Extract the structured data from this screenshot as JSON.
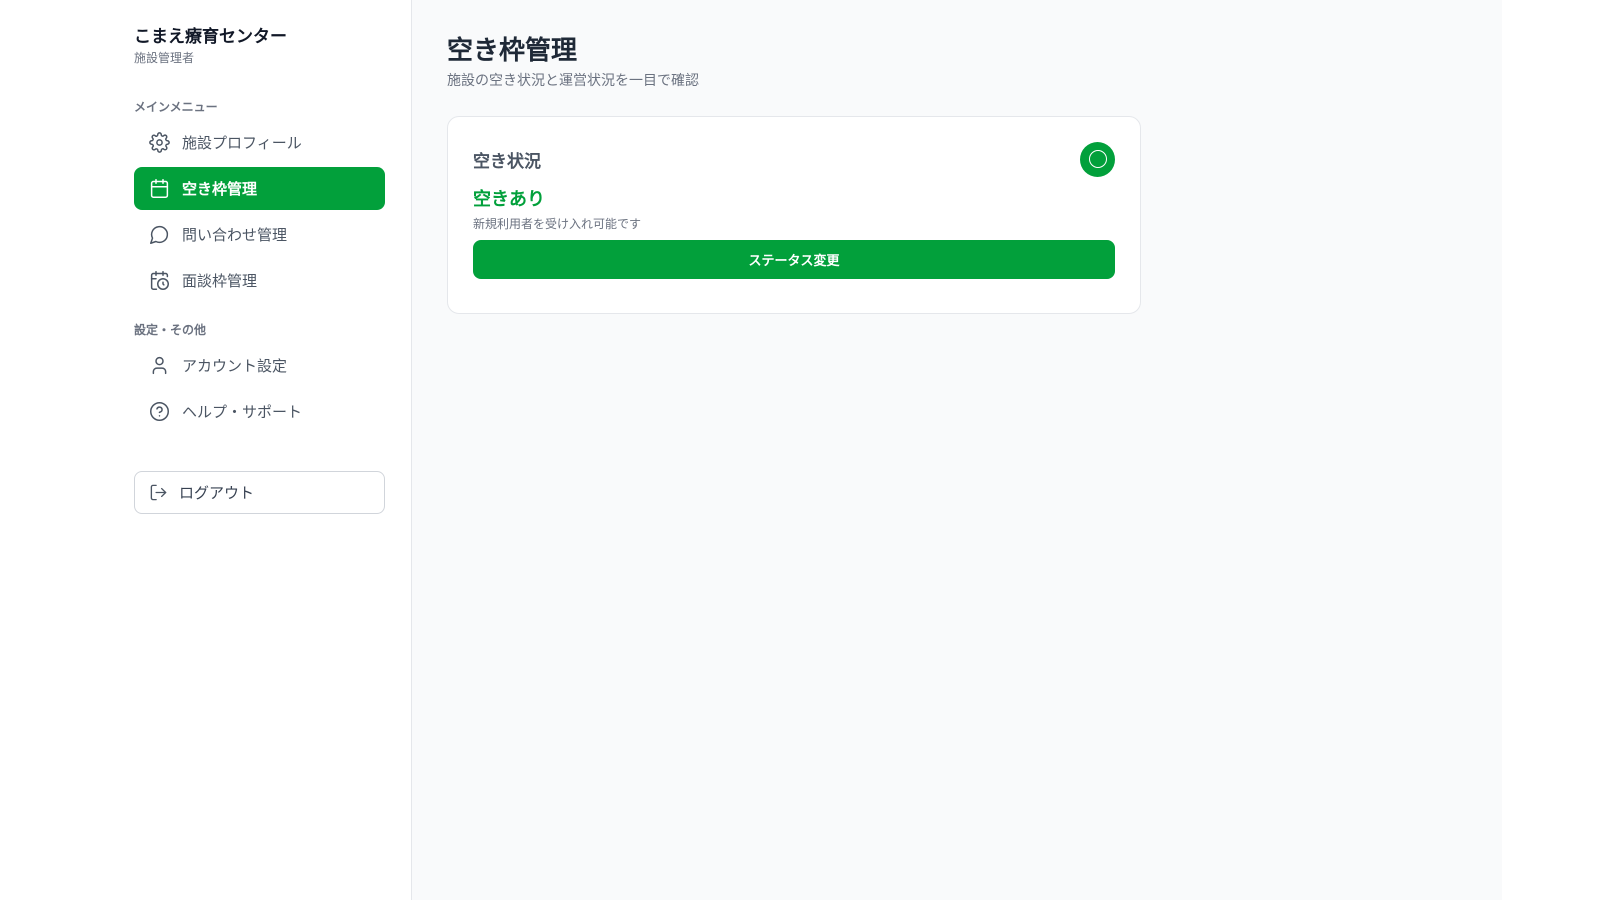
{
  "sidebar": {
    "brand_title": "こまえ療育センター",
    "brand_sub": "施設管理者",
    "section_main": "メインメニュー",
    "main_items": [
      {
        "label": "施設プロフィール",
        "icon": "gear-icon",
        "active": false
      },
      {
        "label": "空き枠管理",
        "icon": "calendar-icon",
        "active": true
      },
      {
        "label": "問い合わせ管理",
        "icon": "chat-bubble-icon",
        "active": false
      },
      {
        "label": "面談枠管理",
        "icon": "calendar-clock-icon",
        "active": false
      }
    ],
    "section_other": "設定・その他",
    "other_items": [
      {
        "label": "アカウント設定",
        "icon": "user-icon"
      },
      {
        "label": "ヘルプ・サポート",
        "icon": "help-circle-icon"
      }
    ],
    "logout_label": "ログアウト"
  },
  "main": {
    "page_title": "空き枠管理",
    "page_sub": "施設の空き状況と運営状況を一目で確認",
    "card": {
      "title": "空き状況",
      "status_value": "空きあり",
      "status_desc": "新規利用者を受け入れ可能です",
      "button_label": "ステータス変更"
    }
  },
  "colors": {
    "accent": "#02a03b",
    "main_bg": "#f9fafb",
    "text_muted": "#6b7280"
  }
}
